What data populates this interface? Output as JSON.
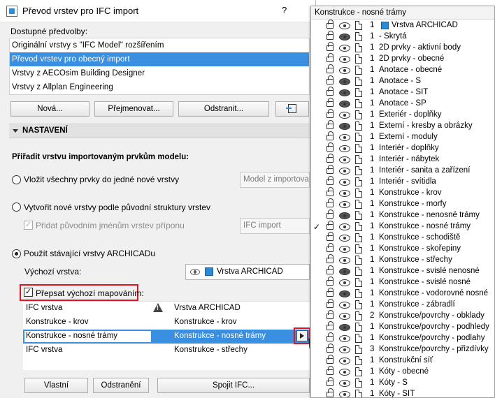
{
  "dialog": {
    "title": "Převod vrstev pro IFC import",
    "help": "?",
    "presets_label": "Dostupné předvolby:",
    "presets": [
      {
        "label": "Originální vrstvy s \"IFC Model\" rozšířením",
        "selected": false
      },
      {
        "label": "Převod vrstev pro obecný import",
        "selected": true
      },
      {
        "label": "Vrstvy z AECOsim Building Designer",
        "selected": false
      },
      {
        "label": "Vrstvy z Allplan Engineering",
        "selected": false
      }
    ],
    "buttons": {
      "new": "Nová...",
      "rename": "Přejmenovat...",
      "delete": "Odstranit..."
    },
    "section_title": "NASTAVENÍ",
    "assign_label": "Přiřadit vrstvu importovaným prvkům modelu:",
    "option_single": "Vložit všechny prvky do jedné nové vrstvy",
    "option_single_value": "Model z importova",
    "option_structure": "Vytvořit nové vrstvy podle původní struktury vrstev",
    "option_suffix": "Přidat původním jménům vrstev příponu",
    "suffix_value": "IFC import",
    "option_existing": "Použít stávající vrstvy ARCHICADu",
    "default_layer_label": "Výchozí vrstva:",
    "default_layer_value": "Vrstva ARCHICAD",
    "override_label": "Přepsat výchozí mapováním:",
    "mapping": [
      {
        "ifc": "IFC vrstva",
        "archicad": "Vrstva ARCHICAD",
        "header": true
      },
      {
        "ifc": "Konstrukce - krov",
        "archicad": "Konstrukce - krov"
      },
      {
        "ifc": "Konstrukce - nosné trámy",
        "archicad": "Konstrukce - nosné trámy",
        "selected": true
      },
      {
        "ifc": "IFC vrstva",
        "archicad": "Konstrukce - střechy"
      }
    ],
    "bottom_buttons": {
      "custom": "Vlastní",
      "remove": "Odstranění",
      "merge": "Spojit IFC..."
    },
    "accent_color": "#3b8fe0",
    "highlight_color": "#e0141e"
  },
  "popup": {
    "header": "Konstrukce - nosné trámy",
    "layers": [
      {
        "num": "1",
        "name": "Vrstva ARCHICAD",
        "archicad_icon": true
      },
      {
        "num": "1",
        "name": "- Skrytá",
        "hidden": true
      },
      {
        "num": "1",
        "name": "2D prvky - aktivní body"
      },
      {
        "num": "1",
        "name": "2D prvky - obecné"
      },
      {
        "num": "1",
        "name": "Anotace - obecné"
      },
      {
        "num": "1",
        "name": "Anotace - S",
        "hidden": true
      },
      {
        "num": "1",
        "name": "Anotace - SIT",
        "hidden": true
      },
      {
        "num": "1",
        "name": "Anotace - SP",
        "hidden": true
      },
      {
        "num": "1",
        "name": "Exteriér - doplňky"
      },
      {
        "num": "1",
        "name": "Externí - kresby a obrázky",
        "hidden": true
      },
      {
        "num": "1",
        "name": "Externí - moduly"
      },
      {
        "num": "1",
        "name": "Interiér - doplňky"
      },
      {
        "num": "1",
        "name": "Interiér - nábytek"
      },
      {
        "num": "1",
        "name": "Interiér - sanita a zařízení"
      },
      {
        "num": "1",
        "name": "Interiér - svítidla"
      },
      {
        "num": "1",
        "name": "Konstrukce - krov"
      },
      {
        "num": "1",
        "name": "Konstrukce - morfy"
      },
      {
        "num": "1",
        "name": "Konstrukce - nenosné trámy",
        "hidden": true
      },
      {
        "num": "1",
        "name": "Konstrukce - nosné trámy",
        "checked": true
      },
      {
        "num": "1",
        "name": "Konstrukce - schodiště"
      },
      {
        "num": "1",
        "name": "Konstrukce - skořepiny"
      },
      {
        "num": "1",
        "name": "Konstrukce - střechy"
      },
      {
        "num": "1",
        "name": "Konstrukce - svislé nenosné",
        "hidden": true
      },
      {
        "num": "1",
        "name": "Konstrukce - svislé nosné"
      },
      {
        "num": "1",
        "name": "Konstrukce - vodorovné nosné",
        "hidden": true
      },
      {
        "num": "1",
        "name": "Konstrukce - zábradlí"
      },
      {
        "num": "2",
        "name": "Konstrukce/povrchy - obklady"
      },
      {
        "num": "1",
        "name": "Konstrukce/povrchy - podhledy",
        "hidden": true
      },
      {
        "num": "1",
        "name": "Konstrukce/povrchy - podlahy"
      },
      {
        "num": "3",
        "name": "Konstrukce/povrchy - přizdívky"
      },
      {
        "num": "1",
        "name": "Konstrukční síť"
      },
      {
        "num": "1",
        "name": "Kóty - obecné"
      },
      {
        "num": "1",
        "name": "Kóty - S"
      },
      {
        "num": "1",
        "name": "Kóty - SIT"
      }
    ]
  }
}
